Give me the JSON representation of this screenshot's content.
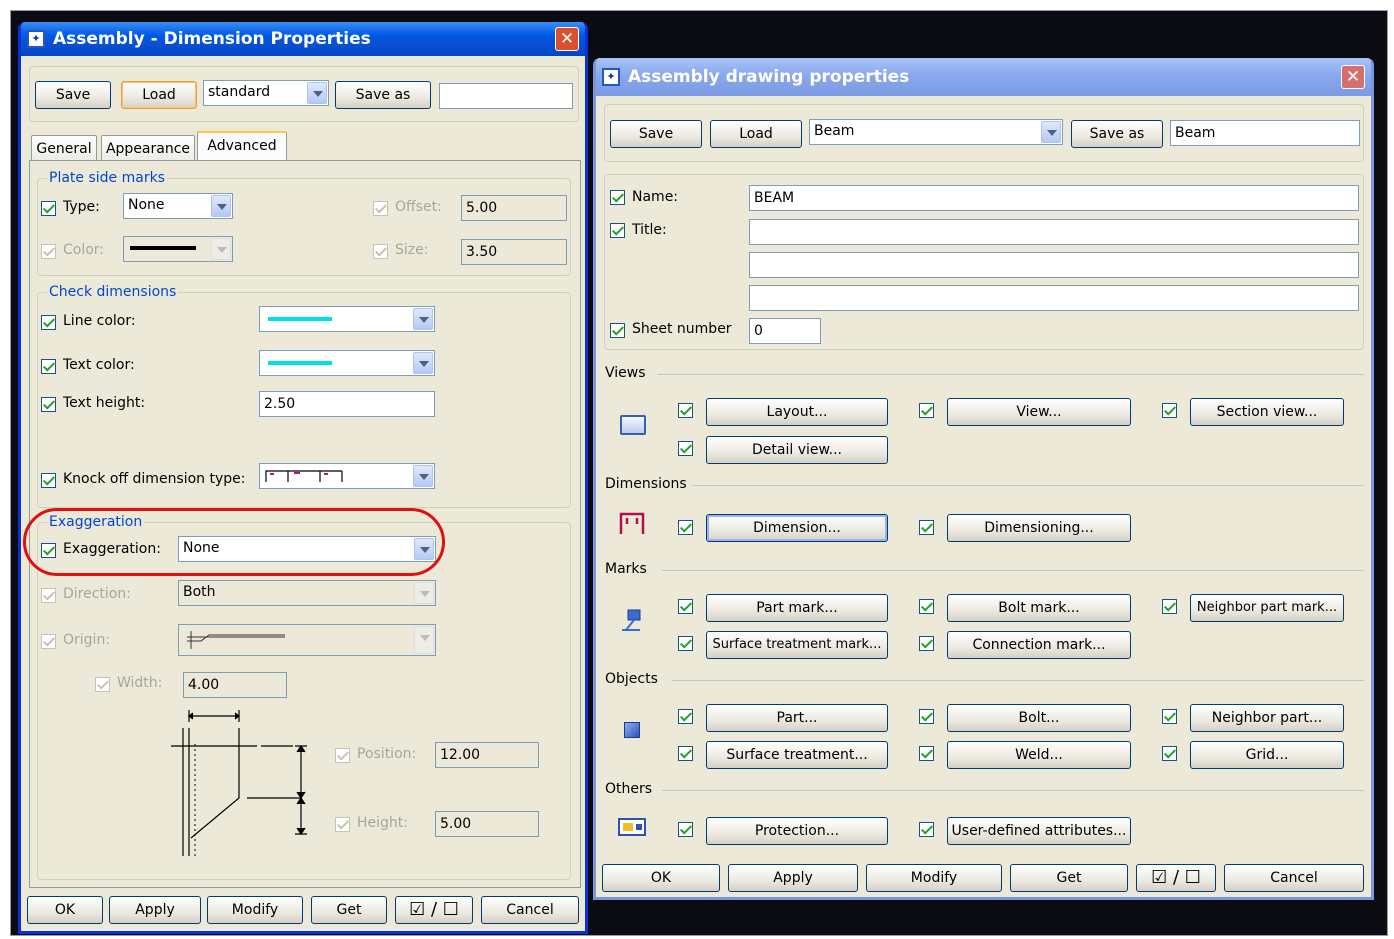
{
  "w1": {
    "title": "Assembly - Dimension Properties",
    "save": "Save",
    "load": "Load",
    "preset": "standard",
    "save_as": "Save as",
    "save_as_name": "",
    "tabs": [
      "General",
      "Appearance",
      "Advanced"
    ],
    "plate": {
      "group": "Plate side marks",
      "type_label": "Type:",
      "type_value": "None",
      "offset_label": "Offset:",
      "offset_value": "5.00",
      "color_label": "Color:",
      "size_label": "Size:",
      "size_value": "3.50"
    },
    "check": {
      "group": "Check dimensions",
      "line_color_label": "Line color:",
      "text_color_label": "Text color:",
      "text_height_label": "Text height:",
      "text_height_value": "2.50",
      "knock_label": "Knock off dimension type:",
      "swatch_color": "#00e0e8"
    },
    "exag": {
      "group": "Exaggeration",
      "exag_label": "Exaggeration:",
      "exag_value": "None",
      "direction_label": "Direction:",
      "direction_value": "Both",
      "origin_label": "Origin:",
      "width_label": "Width:",
      "width_value": "4.00",
      "position_label": "Position:",
      "position_value": "12.00",
      "height_label": "Height:",
      "height_value": "5.00"
    },
    "footer": {
      "ok": "OK",
      "apply": "Apply",
      "modify": "Modify",
      "get": "Get",
      "cancel": "Cancel"
    }
  },
  "w2": {
    "title": "Assembly drawing properties",
    "save": "Save",
    "load": "Load",
    "preset": "Beam",
    "save_as": "Save as",
    "save_as_name": "Beam",
    "name_label": "Name:",
    "name_value": "BEAM",
    "title_label": "Title:",
    "title1": "",
    "title2": "",
    "title3": "",
    "sheet_label": "Sheet number",
    "sheet_value": "0",
    "views": {
      "section": "Views",
      "layout": "Layout...",
      "view": "View...",
      "section_view": "Section view...",
      "detail_view": "Detail view..."
    },
    "dimensions": {
      "section": "Dimensions",
      "dimension": "Dimension...",
      "dimensioning": "Dimensioning..."
    },
    "marks": {
      "section": "Marks",
      "part_mark": "Part mark...",
      "bolt_mark": "Bolt mark...",
      "neighbor_part_mark": "Neighbor part mark...",
      "surface_treatment_mark": "Surface treatment mark...",
      "connection_mark": "Connection mark..."
    },
    "objects": {
      "section": "Objects",
      "part": "Part...",
      "bolt": "Bolt...",
      "neighbor_part": "Neighbor part...",
      "surface_treatment": "Surface treatment...",
      "weld": "Weld...",
      "grid": "Grid..."
    },
    "others": {
      "section": "Others",
      "protection": "Protection...",
      "user_defined": "User-defined attributes..."
    },
    "footer": {
      "ok": "OK",
      "apply": "Apply",
      "modify": "Modify",
      "get": "Get",
      "cancel": "Cancel"
    }
  },
  "highlight_color": "#e01010"
}
